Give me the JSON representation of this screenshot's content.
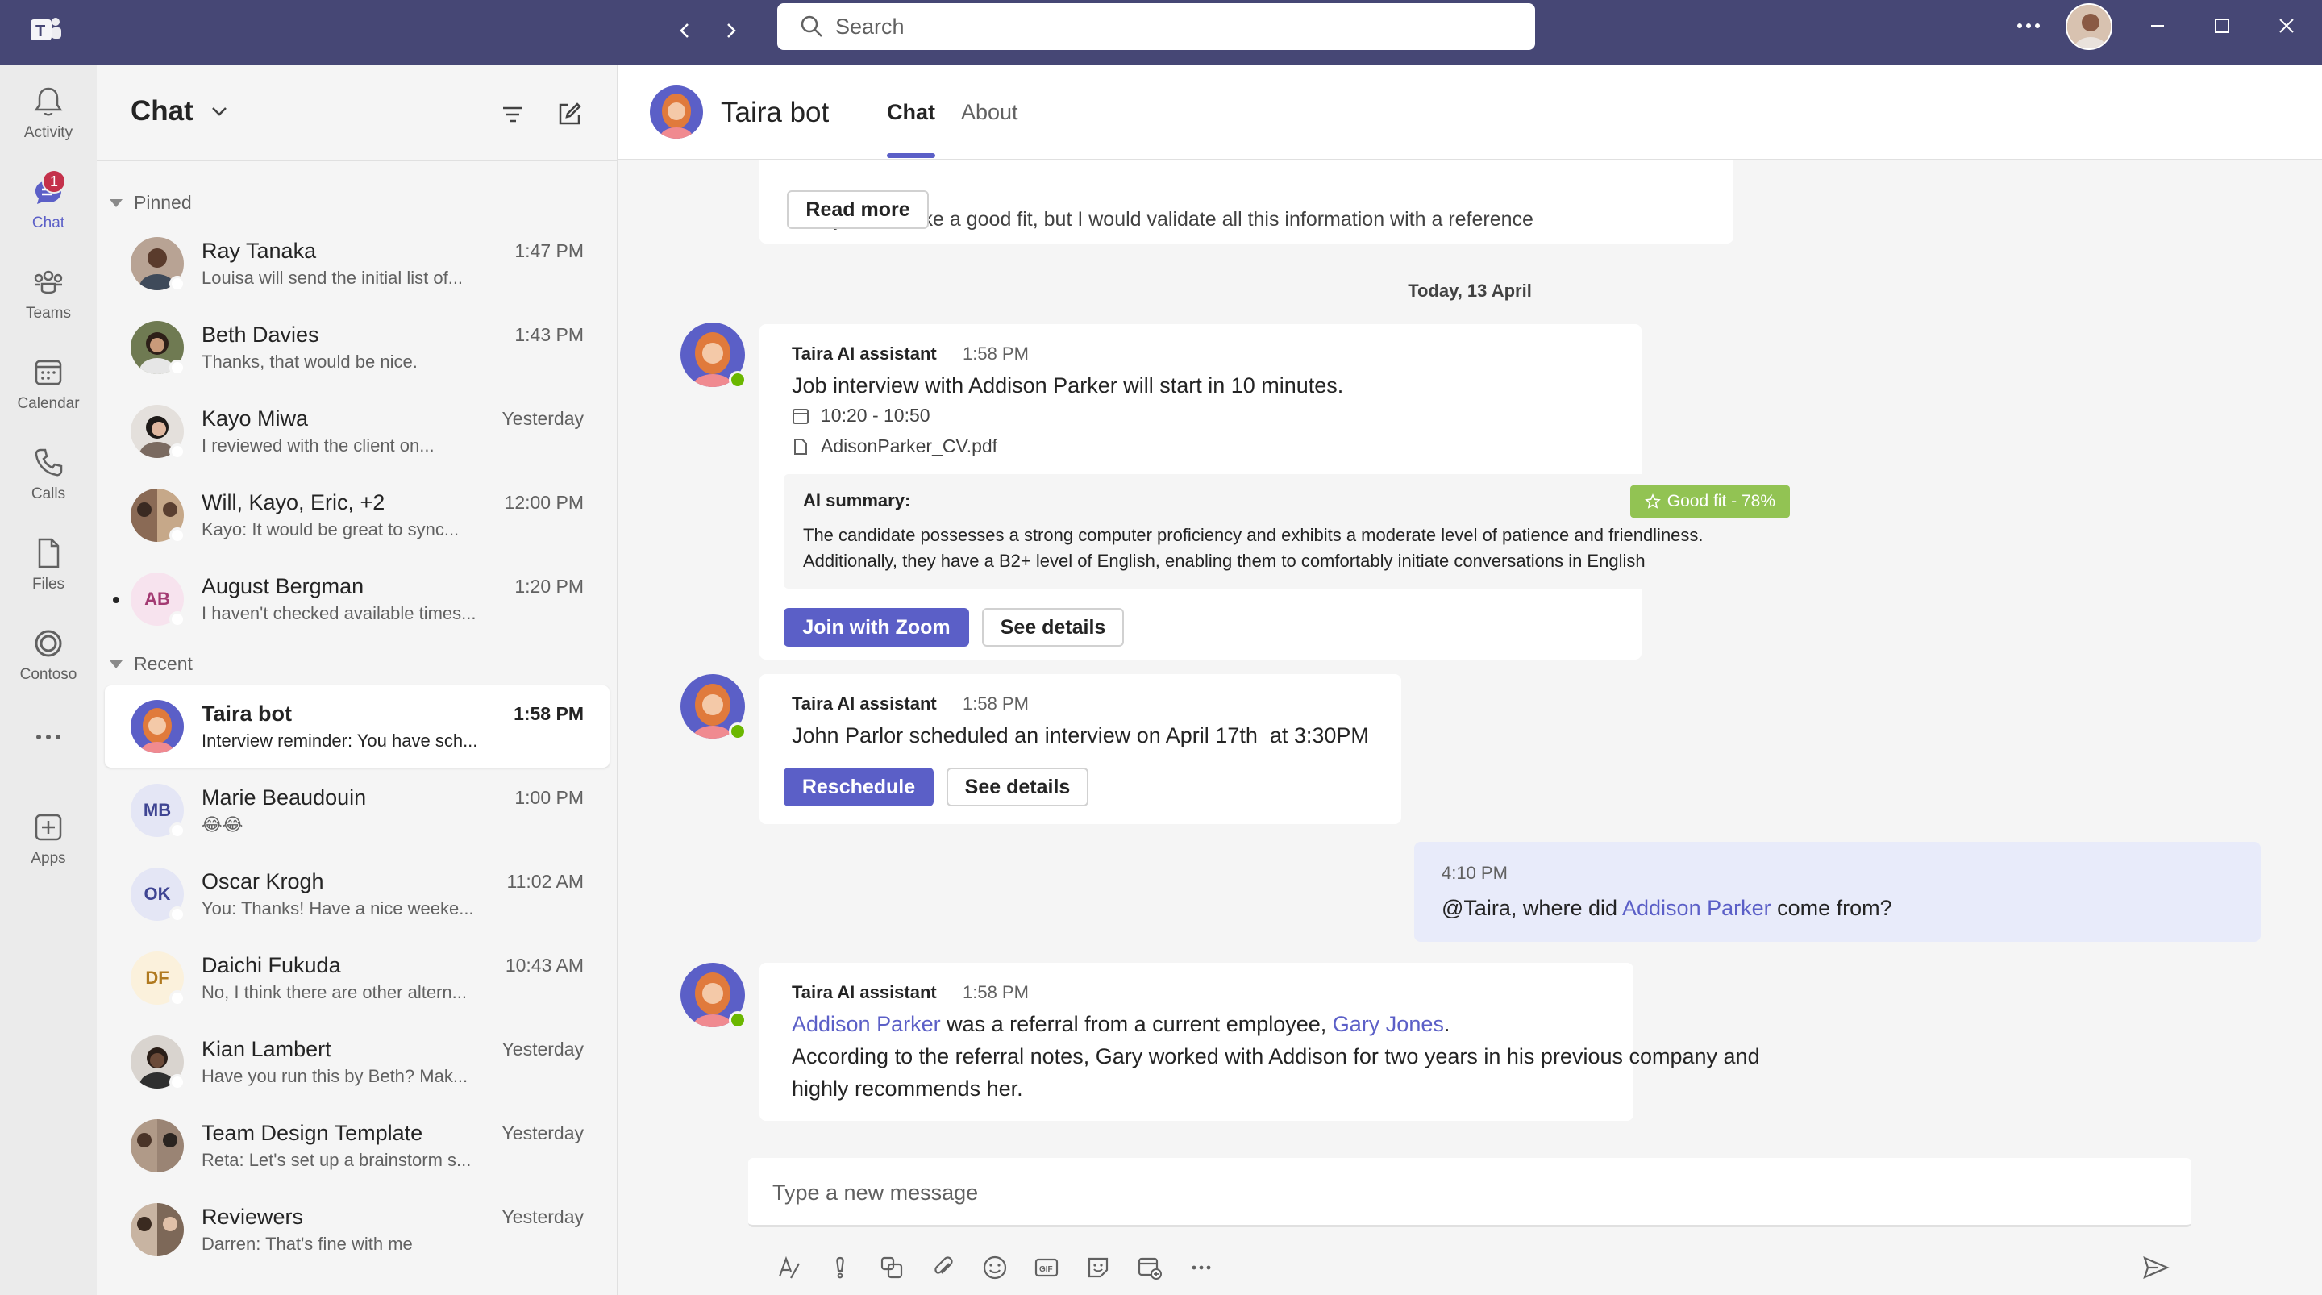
{
  "titlebar": {
    "search_placeholder": "Search",
    "app_icon": "teams-logo-icon",
    "nav_back_icon": "chevron-left-icon",
    "nav_forward_icon": "chevron-right-icon"
  },
  "rail": {
    "items": [
      {
        "label": "Activity",
        "icon": "bell-icon"
      },
      {
        "label": "Chat",
        "icon": "chat-icon",
        "badge": "1"
      },
      {
        "label": "Teams",
        "icon": "teams-icon"
      },
      {
        "label": "Calendar",
        "icon": "calendar-icon"
      },
      {
        "label": "Calls",
        "icon": "phone-icon"
      },
      {
        "label": "Files",
        "icon": "file-icon"
      },
      {
        "label": "Contoso",
        "icon": "contoso-icon"
      },
      {
        "label": "",
        "icon": "more-icon"
      },
      {
        "label": "Apps",
        "icon": "apps-add-icon"
      }
    ]
  },
  "chatlist": {
    "title": "Chat",
    "pinned_label": "Pinned",
    "recent_label": "Recent",
    "pinned": [
      {
        "name": "Ray Tanaka",
        "preview": "Louisa will send the initial list of...",
        "time": "1:47 PM"
      },
      {
        "name": "Beth Davies",
        "preview": "Thanks, that would be nice.",
        "time": "1:43 PM"
      },
      {
        "name": "Kayo Miwa",
        "preview": "I reviewed with the client on...",
        "time": "Yesterday"
      },
      {
        "name": "Will, Kayo, Eric, +2",
        "preview": "Kayo: It would be great to sync...",
        "time": "12:00 PM"
      },
      {
        "name": "August Bergman",
        "preview": "I haven't checked available times...",
        "time": "1:20 PM",
        "initials": "AB"
      }
    ],
    "recent": [
      {
        "name": "Taira bot",
        "preview": "Interview reminder: You have sch...",
        "time": "1:58 PM"
      },
      {
        "name": "Marie Beaudouin",
        "preview": "😂😂",
        "time": "1:00 PM",
        "initials": "MB"
      },
      {
        "name": "Oscar Krogh",
        "preview": "You: Thanks! Have a nice weeke...",
        "time": "11:02 AM",
        "initials": "OK"
      },
      {
        "name": "Daichi Fukuda",
        "preview": "No, I think there are other altern...",
        "time": "10:43 AM",
        "initials": "DF"
      },
      {
        "name": "Kian Lambert",
        "preview": "Have you run this by Beth? Mak...",
        "time": "Yesterday"
      },
      {
        "name": "Team Design Template",
        "preview": "Reta: Let's set up a brainstorm s...",
        "time": "Yesterday"
      },
      {
        "name": "Reviewers",
        "preview": "Darren: That's fine with me",
        "time": "Yesterday"
      }
    ]
  },
  "conversation": {
    "title": "Taira bot",
    "tabs": [
      "Chat",
      "About"
    ],
    "truncated_text": "Haley seems like a good fit, but I would validate all this information with a reference",
    "read_more": "Read more",
    "date_divider": "Today, 13 April",
    "msg1": {
      "sender": "Taira AI assistant",
      "time": "1:58 PM",
      "text": "Job interview with Addison Parker will start in 10 minutes.",
      "slot": "10:20 - 10:50",
      "file": "AdisonParker_CV.pdf",
      "summary_title": "AI summary:",
      "badge": "Good fit - 78%",
      "summary_line1": "The candidate possesses a strong computer proficiency and exhibits a moderate level of patience and friendliness.",
      "summary_line2": "Additionally, they have a B2+ level of English, enabling them to comfortably initiate conversations in English",
      "primary_btn": "Join with Zoom",
      "secondary_btn": "See details"
    },
    "msg2": {
      "sender": "Taira AI assistant",
      "time": "1:58 PM",
      "text": "John Parlor scheduled an interview on April 17th  at 3:30PM",
      "primary_btn": "Reschedule",
      "secondary_btn": "See details"
    },
    "mine": {
      "time": "4:10 PM",
      "text_pre": "@Taira, where did ",
      "mention": "Addison Parker",
      "text_post": " come from?"
    },
    "msg3": {
      "sender": "Taira AI assistant",
      "time": "1:58 PM",
      "link1": "Addison Parker",
      "mid": " was a referral from a current employee, ",
      "link2": "Gary Jones",
      "end": ".",
      "line2": "According to the referral notes, Gary worked with Addison for two years in his previous company and",
      "line3": "highly recommends her."
    },
    "composer_placeholder": "Type a new message"
  },
  "colors": {
    "brand": "#5b5fc7",
    "titlebar": "#464775",
    "goodfit": "#92c353",
    "online": "#6bb700"
  }
}
